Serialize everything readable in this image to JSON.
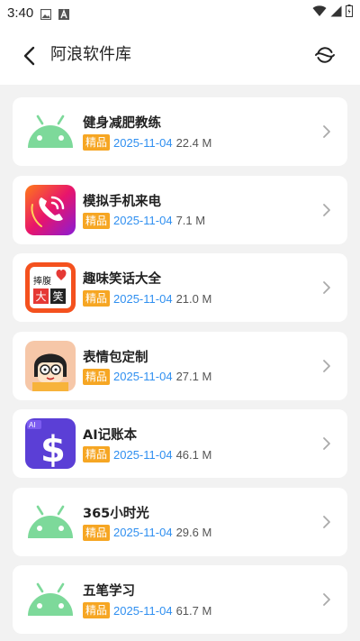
{
  "status_bar": {
    "time": "3:40",
    "icons": [
      "image-icon",
      "a-icon",
      "wifi-icon",
      "signal-icon",
      "battery-icon"
    ]
  },
  "header": {
    "title": "阿浪软件库",
    "back_icon": "back-arrow-icon",
    "refresh_icon": "refresh-icon"
  },
  "apps": [
    {
      "name": "健身减肥教练",
      "badge": "精品",
      "date": "2025-11-04",
      "size": "22.4 M",
      "icon": "android-icon"
    },
    {
      "name": "模拟手机来电",
      "badge": "精品",
      "date": "2025-11-04",
      "size": "7.1 M",
      "icon": "phone-call-icon"
    },
    {
      "name": "趣味笑话大全",
      "badge": "精品",
      "date": "2025-11-04",
      "size": "21.0 M",
      "icon": "joke-icon",
      "icon_text": [
        "捧腹",
        "大",
        "笑"
      ]
    },
    {
      "name": "表情包定制",
      "badge": "精品",
      "date": "2025-11-04",
      "size": "27.1 M",
      "icon": "cartoon-face-icon"
    },
    {
      "name": "AI记账本",
      "badge": "精品",
      "date": "2025-11-04",
      "size": "46.1 M",
      "icon": "dollar-icon",
      "icon_text": [
        "AI",
        "$"
      ]
    },
    {
      "name": "365小时光",
      "badge": "精品",
      "date": "2025-11-04",
      "size": "29.6 M",
      "icon": "android-icon"
    },
    {
      "name": "五笔学习",
      "badge": "精品",
      "date": "2025-11-04",
      "size": "61.7 M",
      "icon": "android-icon"
    }
  ],
  "colors": {
    "badge": "#f6a623",
    "date": "#2f8ff0",
    "android_green": "#7dd99a"
  }
}
